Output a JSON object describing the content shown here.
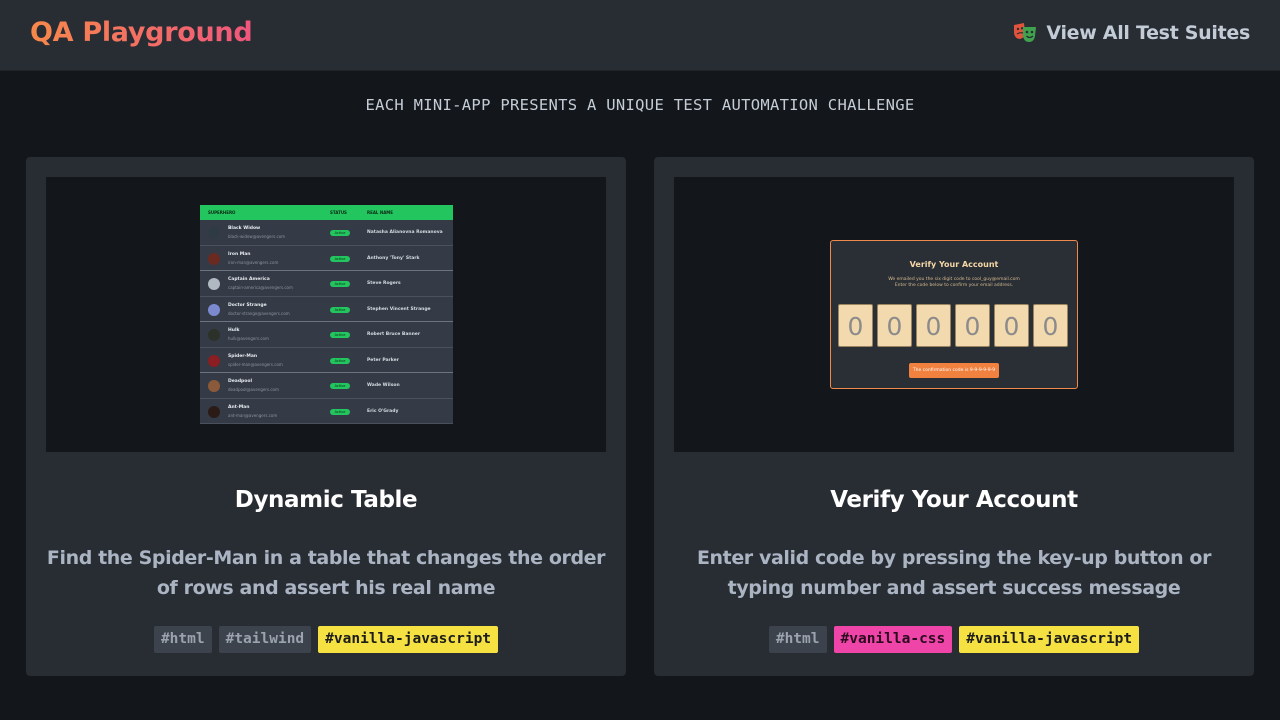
{
  "header": {
    "brand": "QA Playground",
    "nav_link": "View All Test Suites",
    "nav_icon": "theater-masks-icon"
  },
  "tagline": "EACH MINI-APP PRESENTS A UNIQUE TEST AUTOMATION CHALLENGE",
  "cards": [
    {
      "title": "Dynamic Table",
      "description": "Find the Spider-Man in a table that changes the order of rows and assert his real name",
      "tags": [
        "#html",
        "#tailwind",
        "#vanilla-javascript"
      ],
      "preview": {
        "headers": [
          "SUPERHERO",
          "STATUS",
          "REAL NAME"
        ],
        "rows": [
          {
            "name": "Black Widow",
            "email": "black-widow@avengers.com",
            "status": "Active",
            "real_name": "Natasha Alianovna Romanova"
          },
          {
            "name": "Iron Man",
            "email": "iron-man@avengers.com",
            "status": "Active",
            "real_name": "Anthony 'Tony' Stark"
          },
          {
            "name": "Captain America",
            "email": "captain-america@avengers.com",
            "status": "Active",
            "real_name": "Steve Rogers"
          },
          {
            "name": "Doctor Strange",
            "email": "doctor-strange@avengers.com",
            "status": "Active",
            "real_name": "Stephen Vincent Strange"
          },
          {
            "name": "Hulk",
            "email": "hulk@avengers.com",
            "status": "Active",
            "real_name": "Robert Bruce Banner"
          },
          {
            "name": "Spider-Man",
            "email": "spider-man@avengers.com",
            "status": "Active",
            "real_name": "Peter Parker"
          },
          {
            "name": "Deadpool",
            "email": "deadpool@avengers.com",
            "status": "Active",
            "real_name": "Wade Wilson"
          },
          {
            "name": "Ant-Man",
            "email": "ant-man@avengers.com",
            "status": "Active",
            "real_name": "Eric O'Grady"
          }
        ]
      }
    },
    {
      "title": "Verify Your Account",
      "description": "Enter valid code by pressing the key-up button or typing number and assert success message",
      "tags": [
        "#html",
        "#vanilla-css",
        "#vanilla-javascript"
      ],
      "preview": {
        "title": "Verify Your Account",
        "line1": "We emailed you the six digit code to cool_guy@email.com",
        "line2": "Enter the code below to confirm your email address.",
        "digits": [
          "0",
          "0",
          "0",
          "0",
          "0",
          "0"
        ],
        "message": "The confirmation code is 9-9-9-9-9-9"
      }
    }
  ],
  "colors": {
    "brand_gradient_start": "#f7894a",
    "brand_gradient_end": "#f0567d",
    "tag_yellow": "#f5e142",
    "tag_pink": "#ef44a8",
    "tag_gray": "#3c434d",
    "table_header_green": "#22c55e"
  }
}
